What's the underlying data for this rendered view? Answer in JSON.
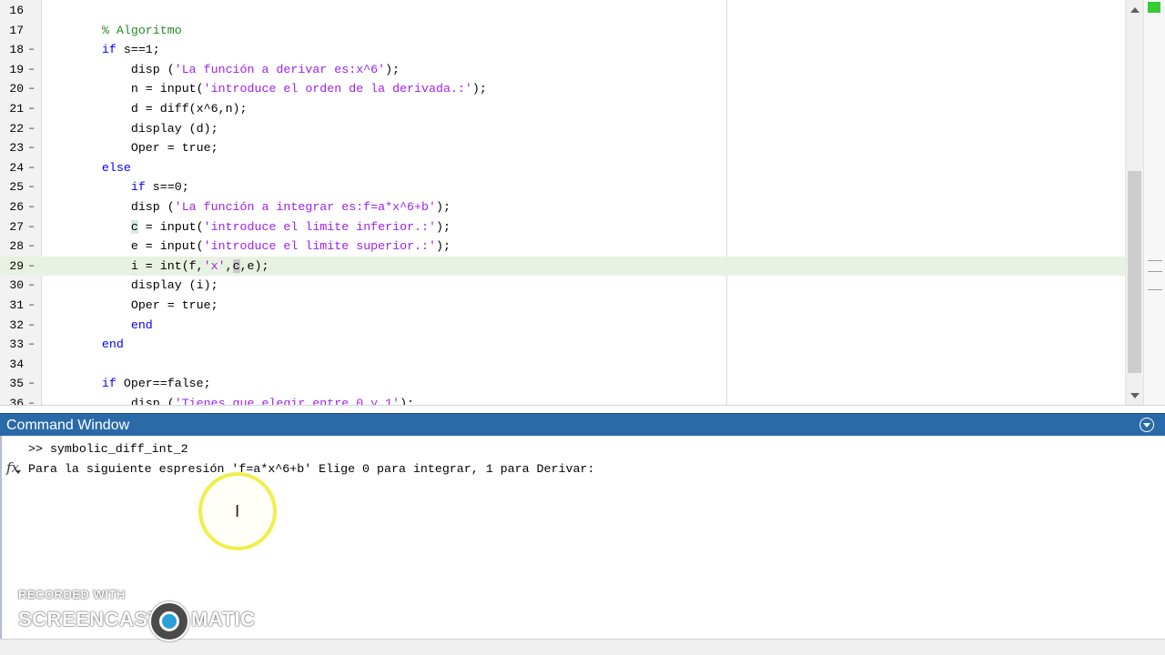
{
  "editor": {
    "lines": [
      {
        "num": "16",
        "breakpoint": false,
        "segments": []
      },
      {
        "num": "17",
        "breakpoint": false,
        "segments": [
          {
            "t": "    % Algoritmo",
            "c": "cmt"
          }
        ]
      },
      {
        "num": "18",
        "breakpoint": true,
        "segments": [
          {
            "t": "    ",
            "c": ""
          },
          {
            "t": "if",
            "c": "kw"
          },
          {
            "t": " s==1;",
            "c": ""
          }
        ]
      },
      {
        "num": "19",
        "breakpoint": true,
        "segments": [
          {
            "t": "        disp (",
            "c": ""
          },
          {
            "t": "'La función a derivar es:x^6'",
            "c": "str"
          },
          {
            "t": ");",
            "c": ""
          }
        ]
      },
      {
        "num": "20",
        "breakpoint": true,
        "segments": [
          {
            "t": "        n = input(",
            "c": ""
          },
          {
            "t": "'introduce el orden de la derivada.:'",
            "c": "str"
          },
          {
            "t": ");",
            "c": ""
          }
        ]
      },
      {
        "num": "21",
        "breakpoint": true,
        "segments": [
          {
            "t": "        d = diff(x^6,n);",
            "c": ""
          }
        ]
      },
      {
        "num": "22",
        "breakpoint": true,
        "segments": [
          {
            "t": "        display (d);",
            "c": ""
          }
        ]
      },
      {
        "num": "23",
        "breakpoint": true,
        "segments": [
          {
            "t": "        Oper = true;",
            "c": ""
          }
        ]
      },
      {
        "num": "24",
        "breakpoint": true,
        "segments": [
          {
            "t": "    ",
            "c": ""
          },
          {
            "t": "else",
            "c": "kw"
          }
        ]
      },
      {
        "num": "25",
        "breakpoint": true,
        "segments": [
          {
            "t": "        ",
            "c": ""
          },
          {
            "t": "if",
            "c": "kw"
          },
          {
            "t": " s==0;",
            "c": ""
          }
        ]
      },
      {
        "num": "26",
        "breakpoint": true,
        "segments": [
          {
            "t": "        disp (",
            "c": ""
          },
          {
            "t": "'La función a integrar es:f=a*x^6+b'",
            "c": "str"
          },
          {
            "t": ");",
            "c": ""
          }
        ]
      },
      {
        "num": "27",
        "breakpoint": true,
        "segments": [
          {
            "t": "        ",
            "c": ""
          },
          {
            "t": "c",
            "c": "hl-var"
          },
          {
            "t": " = input(",
            "c": ""
          },
          {
            "t": "'introduce el limite inferior.:'",
            "c": "str"
          },
          {
            "t": ");",
            "c": ""
          }
        ]
      },
      {
        "num": "28",
        "breakpoint": true,
        "segments": [
          {
            "t": "        e = input(",
            "c": ""
          },
          {
            "t": "'introduce el limite superior.:'",
            "c": "str"
          },
          {
            "t": ");",
            "c": ""
          }
        ]
      },
      {
        "num": "29",
        "breakpoint": true,
        "current": true,
        "segments": [
          {
            "t": "        i = int(f,",
            "c": ""
          },
          {
            "t": "'x'",
            "c": "str"
          },
          {
            "t": ",",
            "c": ""
          },
          {
            "t": "c",
            "c": "hl-sel"
          },
          {
            "t": ",e);",
            "c": ""
          }
        ]
      },
      {
        "num": "30",
        "breakpoint": true,
        "segments": [
          {
            "t": "        display (i);",
            "c": ""
          }
        ]
      },
      {
        "num": "31",
        "breakpoint": true,
        "segments": [
          {
            "t": "        Oper = true;",
            "c": ""
          }
        ]
      },
      {
        "num": "32",
        "breakpoint": true,
        "segments": [
          {
            "t": "        ",
            "c": ""
          },
          {
            "t": "end",
            "c": "kw"
          }
        ]
      },
      {
        "num": "33",
        "breakpoint": true,
        "segments": [
          {
            "t": "    ",
            "c": ""
          },
          {
            "t": "end",
            "c": "kw"
          }
        ]
      },
      {
        "num": "34",
        "breakpoint": false,
        "segments": []
      },
      {
        "num": "35",
        "breakpoint": true,
        "segments": [
          {
            "t": "    ",
            "c": ""
          },
          {
            "t": "if",
            "c": "kw"
          },
          {
            "t": " Oper==false;",
            "c": ""
          }
        ]
      },
      {
        "num": "36",
        "breakpoint": true,
        "segments": [
          {
            "t": "        disp (",
            "c": ""
          },
          {
            "t": "'Tienes que elegir entre 0 y 1'",
            "c": "str"
          },
          {
            "t": ");",
            "c": ""
          }
        ]
      }
    ],
    "breakpoint_glyph": "–"
  },
  "command_window": {
    "title": "Command Window",
    "prompt_line": ">> symbolic_diff_int_2",
    "output_line": "Para la siguiente espresión 'f=a*x^6+b' Elige 0 para integrar, 1 para Derivar:",
    "fx_label": "fx"
  },
  "cursor": {
    "ibeam_glyph": "I"
  },
  "watermark": {
    "line1": "RECORDED WITH",
    "brand_left": "SCREENCAST",
    "brand_right": "MATIC"
  },
  "colors": {
    "keyword": "#0000ff",
    "string": "#a020f0",
    "comment": "#228b22",
    "header_bg": "#2a6aa8",
    "current_line": "#e8f2e2"
  }
}
